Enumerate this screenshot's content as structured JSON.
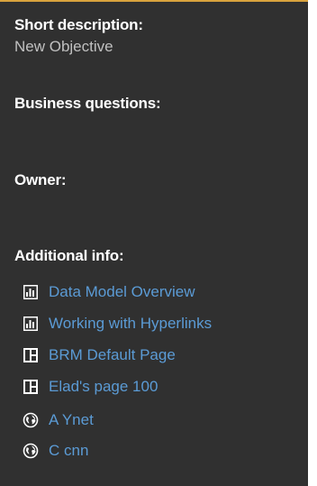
{
  "short_description": {
    "label": "Short description:",
    "value": "New Objective"
  },
  "business_questions": {
    "label": "Business questions:"
  },
  "owner": {
    "label": "Owner:"
  },
  "additional_info": {
    "label": "Additional info:",
    "links": [
      {
        "label": "Data Model Overview",
        "icon": "report-chart-icon"
      },
      {
        "label": "Working with Hyperlinks",
        "icon": "report-chart-icon"
      },
      {
        "label": "BRM Default Page",
        "icon": "dashboard-page-icon"
      },
      {
        "label": "Elad's page 100",
        "icon": "dashboard-page-icon"
      },
      {
        "label": "A Ynet",
        "icon": "globe-icon"
      },
      {
        "label": "C cnn",
        "icon": "globe-icon"
      }
    ]
  },
  "colors": {
    "background": "#303030",
    "accent_border": "#d9a23d",
    "heading": "#ffffff",
    "value": "#c0c0c0",
    "link": "#5b9bd5"
  }
}
